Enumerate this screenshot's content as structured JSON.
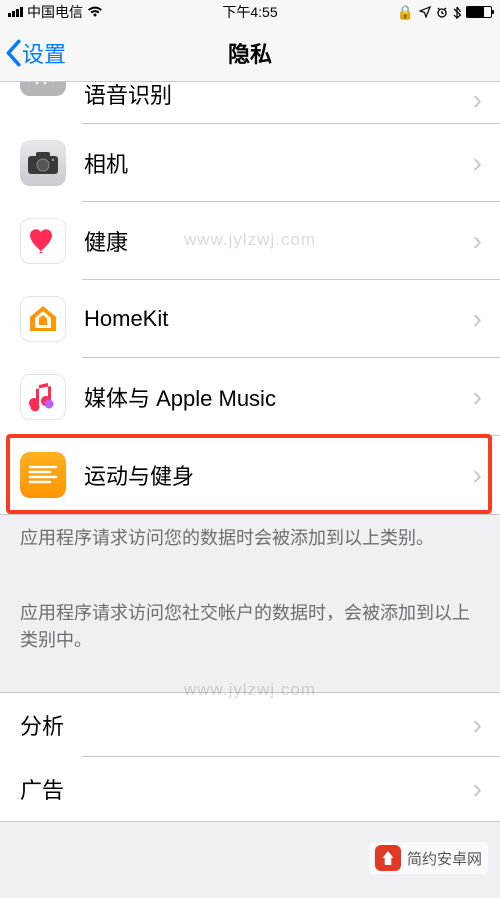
{
  "status_bar": {
    "carrier": "中国电信",
    "time": "下午4:55"
  },
  "nav": {
    "back_label": "设置",
    "title": "隐私"
  },
  "items": {
    "speech": {
      "label": "语音识别"
    },
    "camera": {
      "label": "相机"
    },
    "health": {
      "label": "健康"
    },
    "homekit": {
      "label": "HomeKit"
    },
    "media": {
      "label": "媒体与 Apple Music"
    },
    "motion": {
      "label": "运动与健身"
    },
    "analytics": {
      "label": "分析"
    },
    "ads": {
      "label": "广告"
    }
  },
  "footer": {
    "text1": "应用程序请求访问您的数据时会被添加到以上类别。",
    "text2": "应用程序请求访问您社交帐户的数据时，会被添加到以上类别中。"
  },
  "watermark": "www.jylzwj.com",
  "brand": "简约安卓网"
}
